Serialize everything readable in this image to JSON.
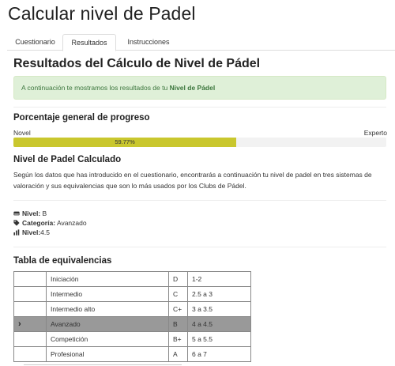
{
  "page_title": "Calcular nivel de Padel",
  "tabs": [
    {
      "label": "Cuestionario",
      "active": false
    },
    {
      "label": "Resultados",
      "active": true
    },
    {
      "label": "Instrucciones",
      "active": false
    }
  ],
  "results": {
    "title": "Resultados del Cálculo de Nivel de Pádel",
    "alert_prefix": "A continuación te mostramos los resultados de tu ",
    "alert_strong": "Nivel de Pádel",
    "alert_color": "#3c763d"
  },
  "progress": {
    "title": "Porcentaje general de progreso",
    "min_label": "Novel",
    "max_label": "Experto",
    "value_text": "59.77%",
    "value": 59.77,
    "bar_color": "#c9c72e"
  },
  "calculated": {
    "title": "Nivel de Padel Calculado",
    "description": "Según los datos que has introducido en el cuestionario, encontrarás a continuación tu nivel de padel en tres sistemas de valoración y sus equivalencias que son lo más usados por los Clubs de Pádel.",
    "nivel_label": "Nivel:",
    "nivel_value": " B",
    "categoria_label": "Categoría:",
    "categoria_value": " Avanzado",
    "nivel_num_label": "Nivel:",
    "nivel_num_value": "4.5",
    "icons": [
      "hdd-icon",
      "tag-icon",
      "bar-chart-icon"
    ]
  },
  "equivalences": {
    "title": "Tabla de equivalencias",
    "rows": [
      {
        "marker": "",
        "name": "Iniciación",
        "letter": "D",
        "range": "1-2",
        "selected": false
      },
      {
        "marker": "",
        "name": "Intermedio",
        "letter": "C",
        "range": "2.5 a 3",
        "selected": false
      },
      {
        "marker": "",
        "name": "Intermedio alto",
        "letter": "C+",
        "range": "3 a 3.5",
        "selected": false
      },
      {
        "marker": "›",
        "name": "Avanzado",
        "letter": "B",
        "range": "4 a 4.5",
        "selected": true
      },
      {
        "marker": "",
        "name": "Competición",
        "letter": "B+",
        "range": "5 a 5.5",
        "selected": false
      },
      {
        "marker": "",
        "name": "Profesional",
        "letter": "A",
        "range": "6 a 7",
        "selected": false
      }
    ],
    "selected_color": "#999999"
  }
}
